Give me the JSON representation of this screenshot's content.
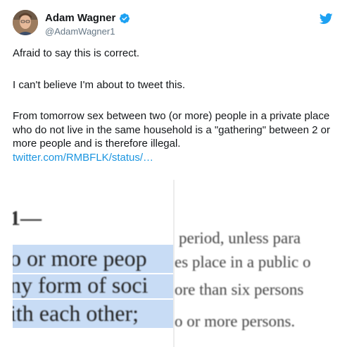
{
  "tweet": {
    "author": {
      "display_name": "Adam Wagner",
      "handle": "@AdamWagner1",
      "verified_icon": "verified-badge-icon",
      "avatar_icon": "avatar"
    },
    "platform_icon": "twitter-bird-icon",
    "paragraphs": [
      "Afraid to say this is correct.",
      "I can't believe I'm about to tweet this.",
      "From tomorrow sex between two (or more) people in a private place who do not live in the same household is a \"gathering\" between 2 or more people and is therefore illegal."
    ],
    "link_text": "twitter.com/RMBFLK/status/…",
    "colors": {
      "link": "#1b95e0",
      "verified": "#1da1f2",
      "handle": "#657786",
      "highlight": "#c8dcf5"
    }
  },
  "media": {
    "left_fragments": [
      "1—",
      "o or more peop",
      "ny form of soci",
      "ith each other;"
    ],
    "right_fragments": [
      "period, unless para",
      "es place in a public o",
      "ore than six persons",
      "o or more persons."
    ]
  }
}
